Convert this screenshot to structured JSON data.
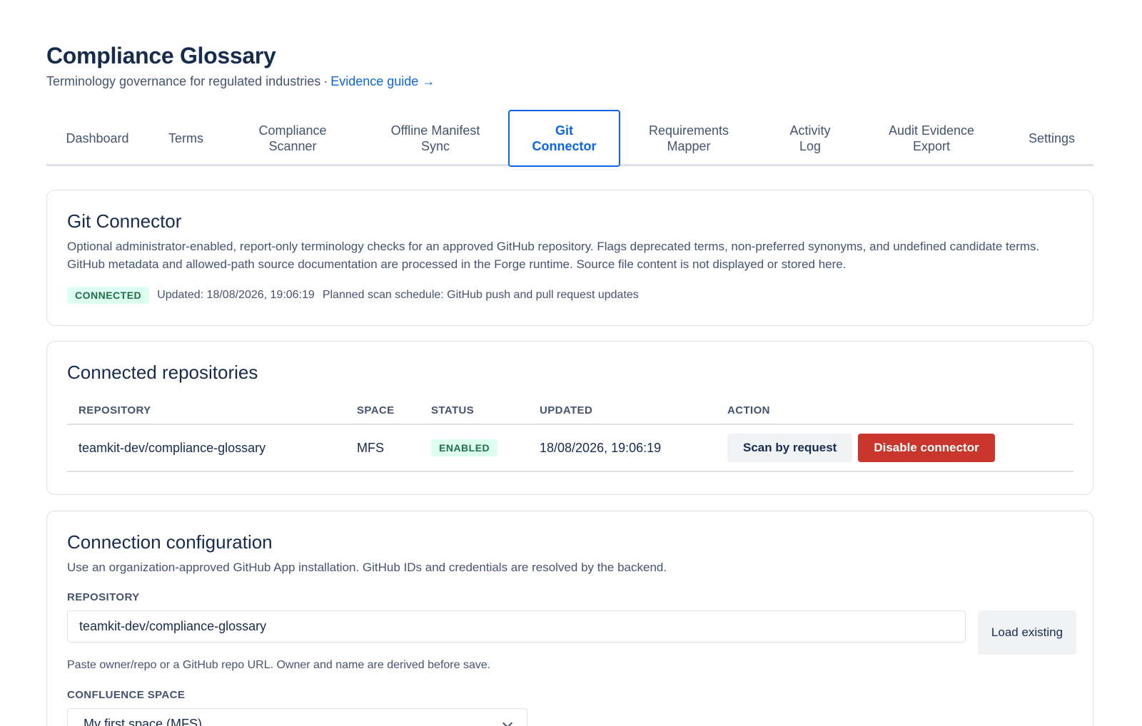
{
  "header": {
    "title": "Compliance Glossary",
    "subtitle": "Terminology governance for regulated industries",
    "separator": "·",
    "guide_link": "Evidence guide →"
  },
  "tabs": [
    {
      "label": "Dashboard"
    },
    {
      "label": "Terms"
    },
    {
      "label": "Compliance Scanner"
    },
    {
      "label": "Offline Manifest Sync"
    },
    {
      "label": "Git Connector",
      "active": true
    },
    {
      "label": "Requirements Mapper"
    },
    {
      "label": "Activity Log"
    },
    {
      "label": "Audit Evidence Export"
    },
    {
      "label": "Settings"
    }
  ],
  "connector": {
    "title": "Git Connector",
    "description": "Optional administrator-enabled, report-only terminology checks for an approved GitHub repository. Flags deprecated terms, non-preferred synonyms, and undefined candidate terms. GitHub metadata and allowed-path source documentation are processed in the Forge runtime. Source file content is not displayed or stored here.",
    "status_badge": "CONNECTED",
    "updated": "Updated: 18/08/2026, 19:06:19",
    "schedule": "Planned scan schedule: GitHub push and pull request updates"
  },
  "repos": {
    "title": "Connected repositories",
    "columns": [
      "REPOSITORY",
      "SPACE",
      "STATUS",
      "UPDATED",
      "ACTION"
    ],
    "rows": [
      {
        "repository": "teamkit-dev/compliance-glossary",
        "space": "MFS",
        "status": "ENABLED",
        "updated": "18/08/2026, 19:06:19",
        "scan_label": "Scan by request",
        "disable_label": "Disable connector"
      }
    ]
  },
  "config": {
    "title": "Connection configuration",
    "description": "Use an organization-approved GitHub App installation. GitHub IDs and credentials are resolved by the backend.",
    "repo_label": "REPOSITORY",
    "repo_value": "teamkit-dev/compliance-glossary",
    "load_button": "Load existing",
    "helper": "Paste owner/repo or a GitHub repo URL. Owner and name are derived before save.",
    "space_label": "CONFLUENCE SPACE",
    "space_value": "My first space (MFS)"
  },
  "colors": {
    "accent": "#0c66e4",
    "danger": "#c9372c",
    "success_bg": "#dcfff1",
    "success_text": "#216e4e"
  }
}
